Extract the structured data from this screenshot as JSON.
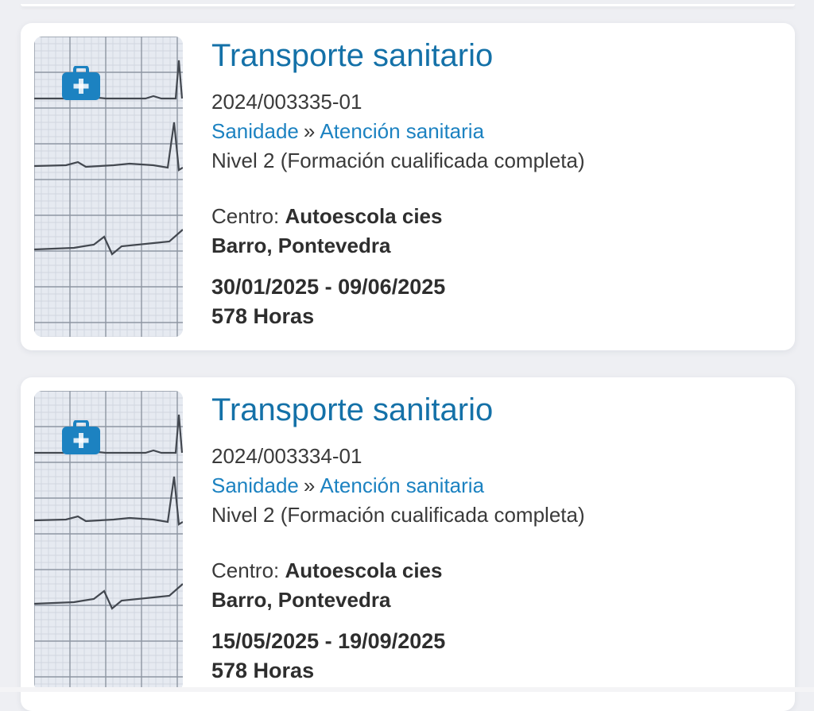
{
  "accent_color": "#1471a8",
  "link_color": "#1c82c1",
  "courses": [
    {
      "icon": "medical-kit-icon",
      "title": "Transporte sanitario",
      "code": "2024/003335-01",
      "family": "Sanidade",
      "separator": "»",
      "area": "Atención sanitaria",
      "level": "Nivel 2 (Formación cualificada completa)",
      "center_label": "Centro:",
      "center_name": "Autoescola cies",
      "location": "Barro, Pontevedra",
      "dates": "30/01/2025 - 09/06/2025",
      "hours": "578 Horas"
    },
    {
      "icon": "medical-kit-icon",
      "title": "Transporte sanitario",
      "code": "2024/003334-01",
      "family": "Sanidade",
      "separator": "»",
      "area": "Atención sanitaria",
      "level": "Nivel 2 (Formación cualificada completa)",
      "center_label": "Centro:",
      "center_name": "Autoescola cies",
      "location": "Barro, Pontevedra",
      "dates": "15/05/2025 - 19/09/2025",
      "hours": "578 Horas"
    }
  ]
}
